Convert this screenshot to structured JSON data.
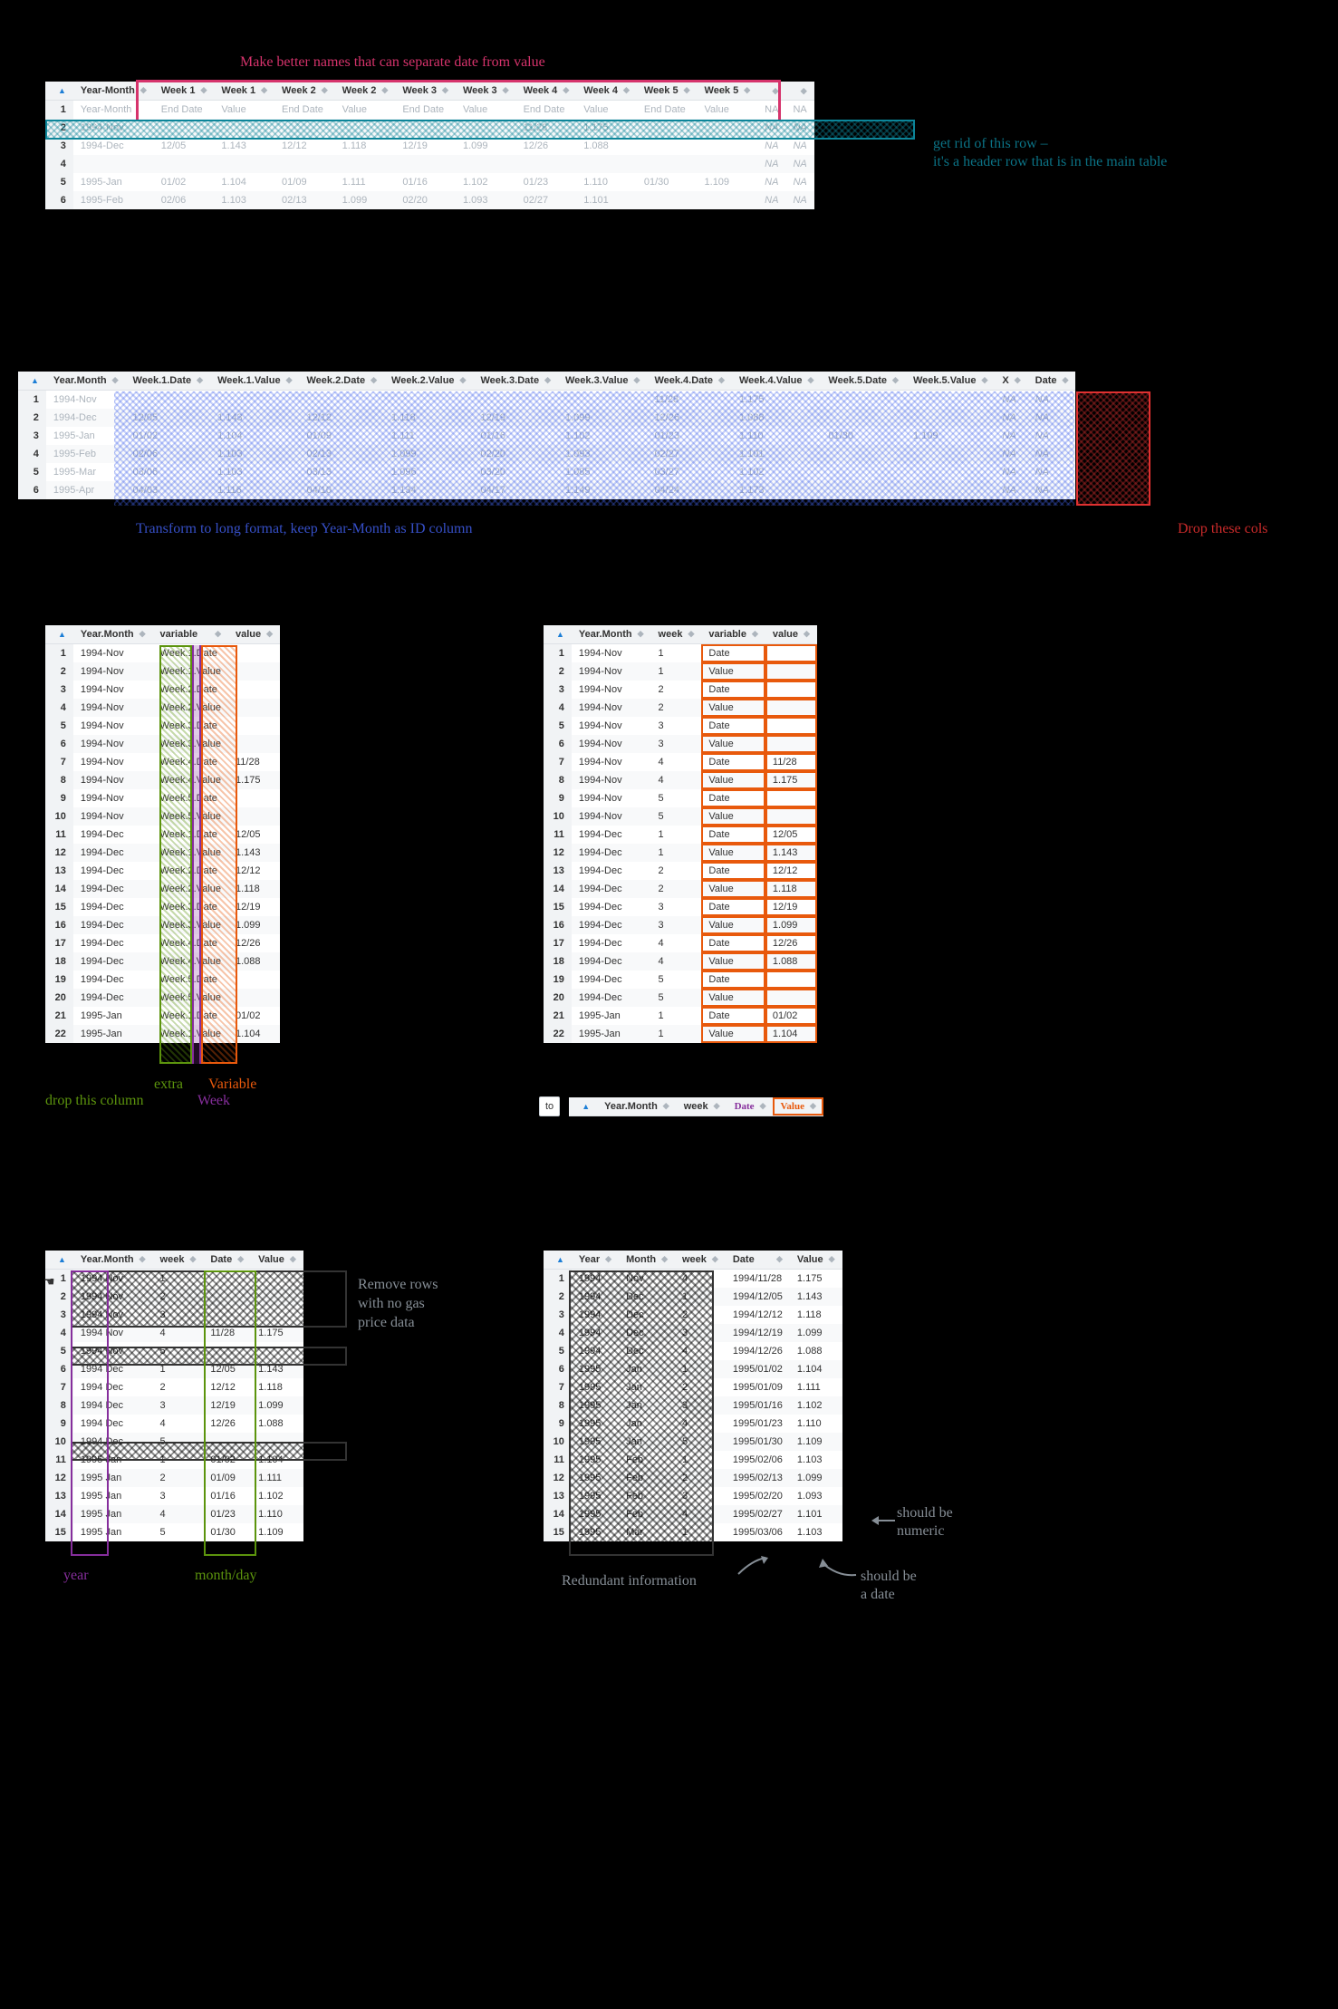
{
  "annotations": {
    "top_pink": "Make better names that can separate date from value",
    "top_teal1": "get rid of this row –",
    "top_teal2": "it's a header row that is in the main table",
    "mid_blue": "Transform to long format, keep Year-Month as ID column",
    "mid_red": "Drop these cols",
    "t3_green_extra": "extra",
    "t3_purple_week": "Week",
    "t3_orange_var": "Variable",
    "t3_drop": "drop this column",
    "t4_to": "to",
    "t4_date": "Date",
    "t4_value": "Value",
    "t5_remove1": "Remove rows",
    "t5_remove2": "with no gas",
    "t5_remove3": "price data",
    "t5_year": "year",
    "t5_monthday": "month/day",
    "t6_redundant": "Redundant information",
    "t6_numeric": "should be\nnumeric",
    "t6_date": "should be\na date"
  },
  "table1": {
    "headers": [
      "Year-Month",
      "Week 1",
      "Week 1",
      "Week 2",
      "Week 2",
      "Week 3",
      "Week 3",
      "Week 4",
      "Week 4",
      "Week 5",
      "Week 5",
      "",
      ""
    ],
    "row1_labels": [
      "Year-Month",
      "End Date",
      "Value",
      "End Date",
      "Value",
      "End Date",
      "Value",
      "End Date",
      "Value",
      "End Date",
      "Value",
      "NA",
      "NA"
    ],
    "rows": [
      [
        "1994-Nov",
        "",
        "",
        "",
        "",
        "",
        "",
        "11/28",
        "1.175",
        "",
        "",
        "NA",
        "NA"
      ],
      [
        "1994-Dec",
        "12/05",
        "1.143",
        "12/12",
        "1.118",
        "12/19",
        "1.099",
        "12/26",
        "1.088",
        "",
        "",
        "NA",
        "NA"
      ],
      [
        "",
        "",
        "",
        "",
        "",
        "",
        "",
        "",
        "",
        "",
        "",
        "NA",
        "NA"
      ],
      [
        "1995-Jan",
        "01/02",
        "1.104",
        "01/09",
        "1.111",
        "01/16",
        "1.102",
        "01/23",
        "1.110",
        "01/30",
        "1.109",
        "NA",
        "NA"
      ],
      [
        "1995-Feb",
        "02/06",
        "1.103",
        "02/13",
        "1.099",
        "02/20",
        "1.093",
        "02/27",
        "1.101",
        "",
        "",
        "NA",
        "NA"
      ]
    ]
  },
  "table2": {
    "headers": [
      "Year.Month",
      "Week.1.Date",
      "Week.1.Value",
      "Week.2.Date",
      "Week.2.Value",
      "Week.3.Date",
      "Week.3.Value",
      "Week.4.Date",
      "Week.4.Value",
      "Week.5.Date",
      "Week.5.Value",
      "X",
      "Date"
    ],
    "rows": [
      [
        "1994-Nov",
        "",
        "",
        "",
        "",
        "",
        "",
        "11/28",
        "1.175",
        "",
        "",
        "NA",
        "NA"
      ],
      [
        "1994-Dec",
        "12/05",
        "1.143",
        "12/12",
        "1.118",
        "12/19",
        "1.099",
        "12/26",
        "1.088",
        "",
        "",
        "NA",
        "NA"
      ],
      [
        "1995-Jan",
        "01/02",
        "1.104",
        "01/09",
        "1.111",
        "01/16",
        "1.102",
        "01/23",
        "1.110",
        "01/30",
        "1.109",
        "NA",
        "NA"
      ],
      [
        "1995-Feb",
        "02/06",
        "1.103",
        "02/13",
        "1.099",
        "02/20",
        "1.093",
        "02/27",
        "1.101",
        "",
        "",
        "NA",
        "NA"
      ],
      [
        "1995-Mar",
        "03/06",
        "1.103",
        "03/13",
        "1.096",
        "03/20",
        "1.085",
        "03/27",
        "1.102",
        "",
        "",
        "NA",
        "NA"
      ],
      [
        "1995-Apr",
        "04/03",
        "1.116",
        "04/10",
        "1.134",
        "04/17",
        "1.149",
        "04/24",
        "1.173",
        "",
        "",
        "NA",
        "NA"
      ]
    ]
  },
  "table3": {
    "headers": [
      "Year.Month",
      "variable",
      "value"
    ],
    "rows": [
      [
        "1994-Nov",
        "Week.1.Date",
        ""
      ],
      [
        "1994-Nov",
        "Week.1.Value",
        ""
      ],
      [
        "1994-Nov",
        "Week.2.Date",
        ""
      ],
      [
        "1994-Nov",
        "Week.2.Value",
        ""
      ],
      [
        "1994-Nov",
        "Week.3.Date",
        ""
      ],
      [
        "1994-Nov",
        "Week.3.Value",
        ""
      ],
      [
        "1994-Nov",
        "Week.4.Date",
        "11/28"
      ],
      [
        "1994-Nov",
        "Week.4.Value",
        "1.175"
      ],
      [
        "1994-Nov",
        "Week.5.Date",
        ""
      ],
      [
        "1994-Nov",
        "Week.5.Value",
        ""
      ],
      [
        "1994-Dec",
        "Week.1.Date",
        "12/05"
      ],
      [
        "1994-Dec",
        "Week.1.Value",
        "1.143"
      ],
      [
        "1994-Dec",
        "Week.2.Date",
        "12/12"
      ],
      [
        "1994-Dec",
        "Week.2.Value",
        "1.118"
      ],
      [
        "1994-Dec",
        "Week.3.Date",
        "12/19"
      ],
      [
        "1994-Dec",
        "Week.3.Value",
        "1.099"
      ],
      [
        "1994-Dec",
        "Week.4.Date",
        "12/26"
      ],
      [
        "1994-Dec",
        "Week.4.Value",
        "1.088"
      ],
      [
        "1994-Dec",
        "Week.5.Date",
        ""
      ],
      [
        "1994-Dec",
        "Week.5.Value",
        ""
      ],
      [
        "1995-Jan",
        "Week.1.Date",
        "01/02"
      ],
      [
        "1995-Jan",
        "Week.1.Value",
        "1.104"
      ]
    ]
  },
  "table4": {
    "headers": [
      "Year.Month",
      "week",
      "variable",
      "value"
    ],
    "rows": [
      [
        "1994-Nov",
        "1",
        "Date",
        ""
      ],
      [
        "1994-Nov",
        "1",
        "Value",
        ""
      ],
      [
        "1994-Nov",
        "2",
        "Date",
        ""
      ],
      [
        "1994-Nov",
        "2",
        "Value",
        ""
      ],
      [
        "1994-Nov",
        "3",
        "Date",
        ""
      ],
      [
        "1994-Nov",
        "3",
        "Value",
        ""
      ],
      [
        "1994-Nov",
        "4",
        "Date",
        "11/28"
      ],
      [
        "1994-Nov",
        "4",
        "Value",
        "1.175"
      ],
      [
        "1994-Nov",
        "5",
        "Date",
        ""
      ],
      [
        "1994-Nov",
        "5",
        "Value",
        ""
      ],
      [
        "1994-Dec",
        "1",
        "Date",
        "12/05"
      ],
      [
        "1994-Dec",
        "1",
        "Value",
        "1.143"
      ],
      [
        "1994-Dec",
        "2",
        "Date",
        "12/12"
      ],
      [
        "1994-Dec",
        "2",
        "Value",
        "1.118"
      ],
      [
        "1994-Dec",
        "3",
        "Date",
        "12/19"
      ],
      [
        "1994-Dec",
        "3",
        "Value",
        "1.099"
      ],
      [
        "1994-Dec",
        "4",
        "Date",
        "12/26"
      ],
      [
        "1994-Dec",
        "4",
        "Value",
        "1.088"
      ],
      [
        "1994-Dec",
        "5",
        "Date",
        ""
      ],
      [
        "1994-Dec",
        "5",
        "Value",
        ""
      ],
      [
        "1995-Jan",
        "1",
        "Date",
        "01/02"
      ],
      [
        "1995-Jan",
        "1",
        "Value",
        "1.104"
      ]
    ]
  },
  "table4b": {
    "headers": [
      "Year.Month",
      "week",
      "Date",
      "Value"
    ]
  },
  "table5": {
    "headers": [
      "Year.Month",
      "week",
      "Date",
      "Value"
    ],
    "rows": [
      [
        "1994 Nov",
        "1",
        "",
        ""
      ],
      [
        "1994 Nov",
        "2",
        "",
        ""
      ],
      [
        "1994 Nov",
        "3",
        "",
        ""
      ],
      [
        "1994 Nov",
        "4",
        "11/28",
        "1.175"
      ],
      [
        "1994 Nov",
        "5",
        "",
        ""
      ],
      [
        "1994 Dec",
        "1",
        "12/05",
        "1.143"
      ],
      [
        "1994 Dec",
        "2",
        "12/12",
        "1.118"
      ],
      [
        "1994 Dec",
        "3",
        "12/19",
        "1.099"
      ],
      [
        "1994 Dec",
        "4",
        "12/26",
        "1.088"
      ],
      [
        "1994 Dec",
        "5",
        "",
        ""
      ],
      [
        "1995 Jan",
        "1",
        "01/02",
        "1.104"
      ],
      [
        "1995 Jan",
        "2",
        "01/09",
        "1.111"
      ],
      [
        "1995 Jan",
        "3",
        "01/16",
        "1.102"
      ],
      [
        "1995 Jan",
        "4",
        "01/23",
        "1.110"
      ],
      [
        "1995 Jan",
        "5",
        "01/30",
        "1.109"
      ]
    ]
  },
  "table6": {
    "headers": [
      "Year",
      "Month",
      "week",
      "Date",
      "Value"
    ],
    "rows": [
      [
        "1994",
        "Nov",
        "4",
        "1994/11/28",
        "1.175"
      ],
      [
        "1994",
        "Dec",
        "1",
        "1994/12/05",
        "1.143"
      ],
      [
        "1994",
        "Dec",
        "2",
        "1994/12/12",
        "1.118"
      ],
      [
        "1994",
        "Dec",
        "3",
        "1994/12/19",
        "1.099"
      ],
      [
        "1994",
        "Dec",
        "4",
        "1994/12/26",
        "1.088"
      ],
      [
        "1995",
        "Jan",
        "1",
        "1995/01/02",
        "1.104"
      ],
      [
        "1995",
        "Jan",
        "2",
        "1995/01/09",
        "1.111"
      ],
      [
        "1995",
        "Jan",
        "3",
        "1995/01/16",
        "1.102"
      ],
      [
        "1995",
        "Jan",
        "4",
        "1995/01/23",
        "1.110"
      ],
      [
        "1995",
        "Jan",
        "5",
        "1995/01/30",
        "1.109"
      ],
      [
        "1995",
        "Feb",
        "1",
        "1995/02/06",
        "1.103"
      ],
      [
        "1995",
        "Feb",
        "2",
        "1995/02/13",
        "1.099"
      ],
      [
        "1995",
        "Feb",
        "3",
        "1995/02/20",
        "1.093"
      ],
      [
        "1995",
        "Feb",
        "4",
        "1995/02/27",
        "1.101"
      ],
      [
        "1995",
        "Mar",
        "1",
        "1995/03/06",
        "1.103"
      ]
    ]
  }
}
